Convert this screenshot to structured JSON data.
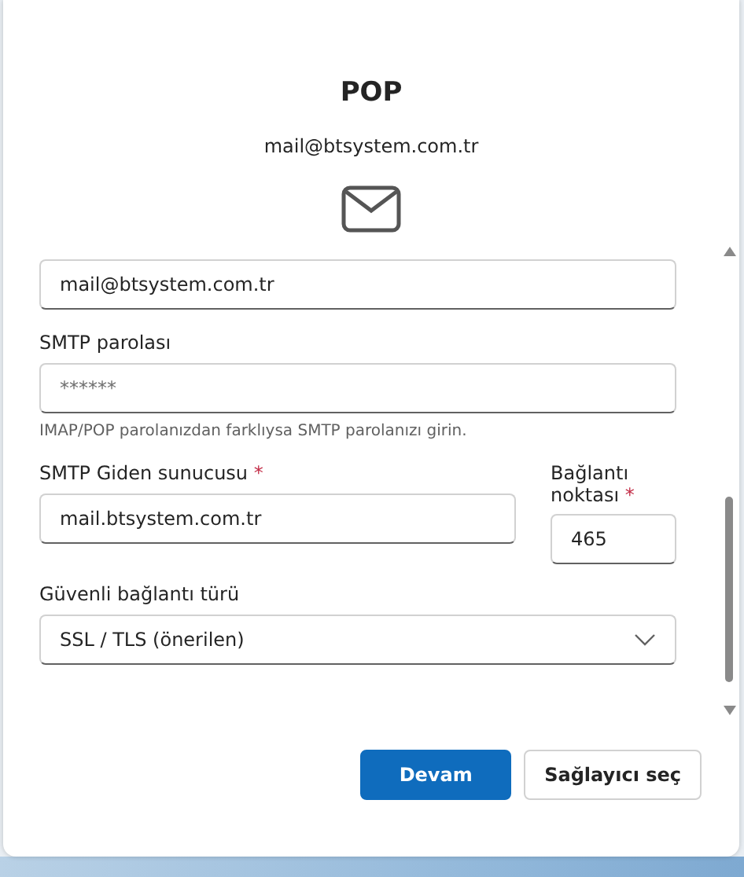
{
  "dialog": {
    "title": "POP",
    "account": "mail@btsystem.com.tr"
  },
  "fields": [
    {
      "value": "mail@btsystem.com.tr"
    },
    {
      "label": "SMTP parolası",
      "placeholder": "******",
      "hint": "IMAP/POP parolanızdan farklıysa SMTP parolanızı girin."
    }
  ],
  "server_row": [
    {
      "label": "SMTP Giden sunucusu",
      "required_mark": "*",
      "value": "mail.btsystem.com.tr"
    },
    {
      "label": "Bağlantı noktası",
      "required_mark": "*",
      "value": "465"
    }
  ],
  "security": {
    "label": "Güvenli bağlantı türü",
    "value": "SSL / TLS (önerilen)"
  },
  "buttons": [
    {
      "label": "Devam",
      "kind": "primary"
    },
    {
      "label": "Sağlayıcı seç",
      "kind": "secondary"
    }
  ]
}
